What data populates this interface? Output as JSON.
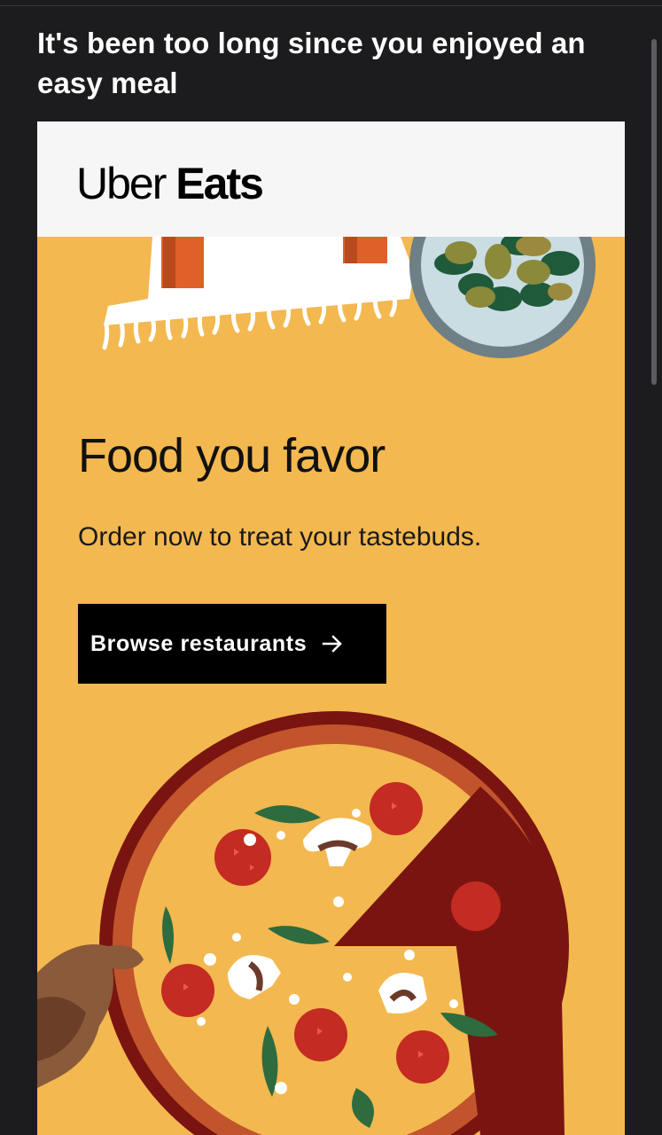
{
  "email": {
    "subject": "It's been too long since you enjoyed an easy meal"
  },
  "header": {
    "logo_part1": "Uber",
    "logo_part2": "Eats"
  },
  "hero": {
    "headline": "Food you favor",
    "subtext": "Order now to treat your tastebuds.",
    "cta_label": "Browse restaurants",
    "cta_icon": "arrow-right-icon"
  },
  "colors": {
    "background": "#1c1c1e",
    "card_background": "#f3b84f",
    "header_background": "#f6f6f6",
    "button_background": "#000000"
  }
}
